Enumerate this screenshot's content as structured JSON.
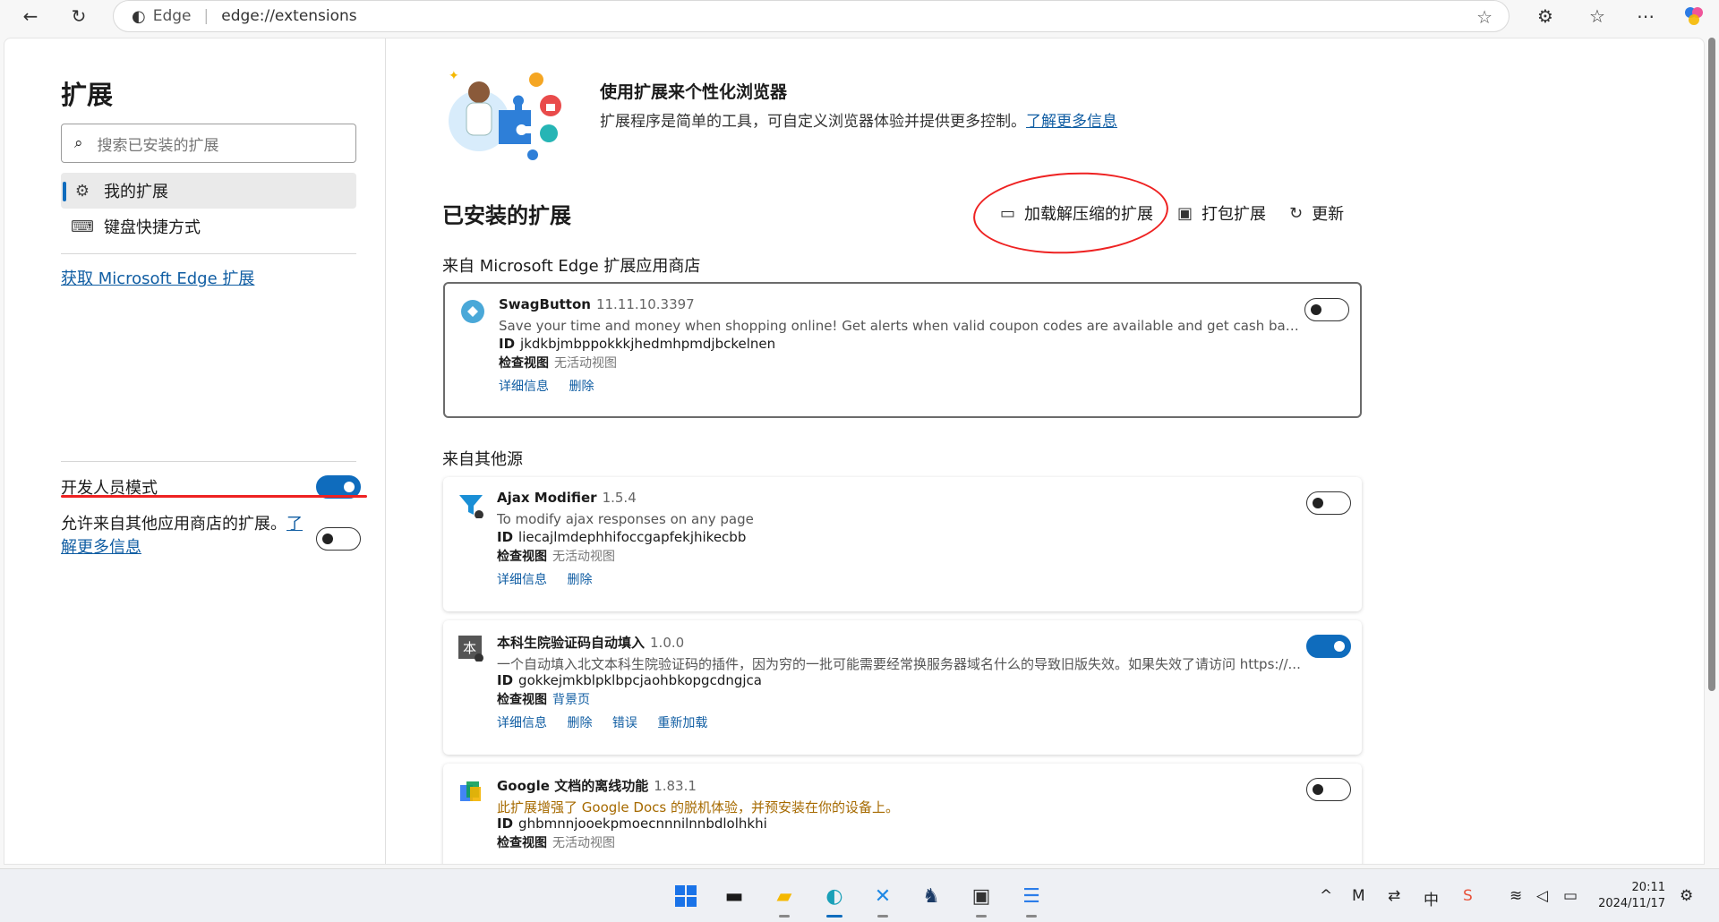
{
  "browser": {
    "site_label": "Edge",
    "url": "edge://extensions"
  },
  "sidebar": {
    "title": "扩展",
    "search_placeholder": "搜索已安装的扩展",
    "items": [
      {
        "label": "我的扩展",
        "icon": "gear-puzzle-icon",
        "active": true
      },
      {
        "label": "键盘快捷方式",
        "icon": "keyboard-icon",
        "active": false
      }
    ],
    "store_link": "获取 Microsoft Edge 扩展",
    "dev_mode_label": "开发人员模式",
    "dev_mode_on": true,
    "allow_other_text": "允许来自其他应用商店的扩展。",
    "allow_other_link": "了解更多信息",
    "allow_other_on": false
  },
  "hero": {
    "title": "使用扩展来个性化浏览器",
    "subtitle": "扩展程序是简单的工具，可自定义浏览器体验并提供更多控制。",
    "link": "了解更多信息"
  },
  "installed": {
    "title": "已安装的扩展",
    "actions": {
      "load_unpacked": "加载解压缩的扩展",
      "pack": "打包扩展",
      "update": "更新"
    }
  },
  "sections": {
    "store": "来自 Microsoft Edge 扩展应用商店",
    "other": "来自其他源"
  },
  "common": {
    "id_label": "ID",
    "inspect_label": "检查视图",
    "details": "详细信息",
    "remove": "删除",
    "errors": "错误",
    "reload": "重新加载"
  },
  "extensions": [
    {
      "name": "SwagButton",
      "version": "11.11.10.3397",
      "desc": "Save your time and money when shopping online! Get alerts when valid coupon codes are available and get cash back.",
      "id": "jkdkbjmbppokkkjhedmhpmdjbckelnen",
      "inspect": "无活动视图",
      "enabled": false
    },
    {
      "name": "Ajax Modifier",
      "version": "1.5.4",
      "desc": "To modify ajax responses on any page",
      "id": "liecajlmdephhifoccgapfekjhikecbb",
      "inspect": "无活动视图",
      "enabled": false
    },
    {
      "name": "本科生院验证码自动填入",
      "version": "1.0.0",
      "desc": "一个自动填入北文本科生院验证码的插件，因为穷的一批可能需要经常换服务器域名什么的导致旧版失效。如果失效了请访问 https://...",
      "id": "gokkejmkblpklbpcjaohbkopgcdngjca",
      "inspect": "背景页",
      "enabled": true
    },
    {
      "name": "Google 文档的离线功能",
      "version": "1.83.1",
      "desc": "此扩展增强了 Google Docs 的脱机体验，并预安装在你的设备上。",
      "id": "ghbmnnjooekpmoecnnnilnnbdlolhkhi",
      "inspect": "无活动视图",
      "enabled": false
    }
  ],
  "taskbar": {
    "time": "20:11",
    "date": "2024/11/17",
    "ime": "中"
  }
}
